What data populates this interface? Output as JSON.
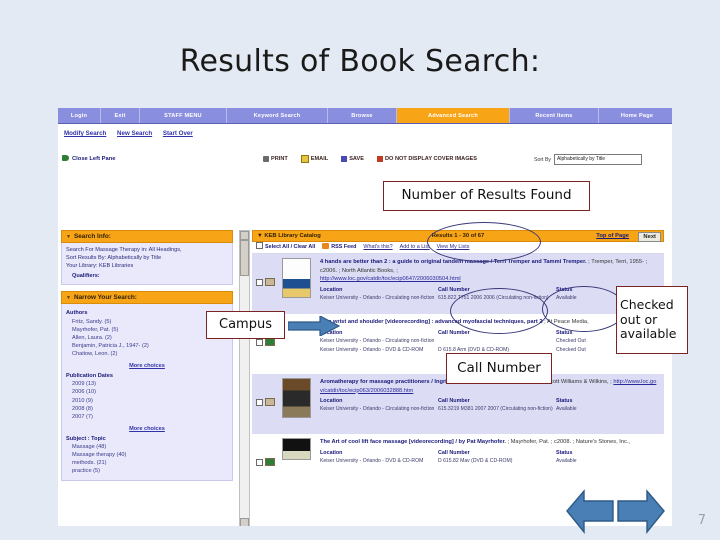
{
  "slide": {
    "title": "Results of Book Search:",
    "page_number": "7",
    "background_color": "#e3eaf3"
  },
  "annotations": {
    "results_found": "Number of Results Found",
    "campus": "Campus",
    "call_number": "Call Number",
    "checked_status": "Checked out or available",
    "accent_color": "#7b2222",
    "ellipse_color": "#3b3b7a",
    "arrow_color": "#4a7fb5"
  },
  "browser": {
    "nav": [
      {
        "label": "Login",
        "active": false
      },
      {
        "label": "Exit",
        "active": false
      },
      {
        "label": "STAFF MENU",
        "active": false
      },
      {
        "label": "Keyword Search",
        "active": false
      },
      {
        "label": "Browse",
        "active": false
      },
      {
        "label": "Advanced Search",
        "active": true
      },
      {
        "label": "Recent Items",
        "active": false
      },
      {
        "label": "Home Page",
        "active": false
      }
    ],
    "sub_links": [
      "Modify Search",
      "New Search",
      "Start Over"
    ],
    "close_pane": "Close Left Pane",
    "actions": [
      {
        "label": "PRINT",
        "icon": "printer-icon"
      },
      {
        "label": "EMAIL",
        "icon": "envelope-icon"
      },
      {
        "label": "SAVE",
        "icon": "floppy-disk-icon"
      },
      {
        "label": "DO NOT DISPLAY COVER IMAGES",
        "icon": "no-image-icon"
      }
    ],
    "sort": {
      "label": "Sort By",
      "value": "Alphabetically by Title"
    }
  },
  "sidebar": {
    "search_info": {
      "header": "Search Info:",
      "lines": [
        "Search For Massage Therapy in: All Headings,",
        "Sort Results By: Alphabetically by Title",
        "Your Library: KEB Libraries"
      ],
      "qualifiers": "Qualifiers:"
    },
    "narrow": {
      "header": "Narrow Your Search:",
      "groups": [
        {
          "name": "Authors",
          "items": [
            "Fritz, Sandy.  (5)",
            "Mayrhofer, Pat.  (5)",
            "Allen, Laura.  (2)",
            "Benjamin, Patricia J., 1947-  (2)",
            "Chaitow, Leon.  (2)"
          ],
          "more": "More choices"
        },
        {
          "name": "Publication Dates",
          "items": [
            "2009  (13)",
            "2006  (10)",
            "2010  (9)",
            "2008  (8)",
            "2007  (7)"
          ],
          "more": "More choices"
        },
        {
          "name": "Subject : Topic",
          "items": [
            "Massage  (48)",
            "Massage therapy  (40)",
            "methods.  (21)",
            "practice  (5)"
          ],
          "more": ""
        }
      ]
    }
  },
  "results": {
    "catalog_label": "KEB Library Catalog",
    "count_text": "Results 1 - 30 of 67",
    "top_of_page": "Top of Page",
    "next_button": "Next",
    "tools": {
      "select_all": "Select All / Clear All",
      "rss": "RSS Feed",
      "whats_this": "What's this?",
      "add_list": "Add to a List",
      "view_lists": "View My Lists"
    },
    "columns": {
      "location": "Location",
      "call_number": "Call Number",
      "status": "Status"
    },
    "items": [
      {
        "title": "4 hands are better than 2 : a guide to original tandem massage / Terri Tremper and Tammi Tremper.",
        "meta": "; Tremper, Terri, 1955- ; c2006. ; North Atlantic Books, ;",
        "url": "http://www.loc.gov/catdir/toc/ecip0647/2006030504.html",
        "copies": [
          {
            "location": "Keiser University - Orlando - Circulating non-fiction",
            "call_number": "615.822 T751 2006 2006 (Circulating non-fiction)",
            "status": "Available"
          }
        ]
      },
      {
        "title": "Arm wrist and shoulder [videorecording] : advanced myofascial techniques, part 2",
        "meta": "; At Peace Media,",
        "url": "",
        "copies": [
          {
            "location": "Keiser University - Orlando - Circulating non-fiction",
            "call_number": "",
            "status": "Checked Out"
          },
          {
            "location": "Keiser University - Orlando - DVD & CD-ROM",
            "call_number": "D 615.8 Arm (DVD & CD-ROM)",
            "status": "Checked Out"
          }
        ]
      },
      {
        "title": "Aromatherapy for massage practitioners / Ingrid Martin.",
        "meta": "; Martin, Ingrid ; c2007. ; Lippincott Williams & Wilkins, ;",
        "url": "http://www.loc.gov/catdir/toc/ecip063/2006032888.htm",
        "copies": [
          {
            "location": "Keiser University - Orlando - Circulating non-fiction",
            "call_number": "615.3219 M381 2007 2007 (Circulating non-fiction)",
            "status": "Available"
          }
        ]
      },
      {
        "title": "The Art of cool lift face massage [videorecording] / by Pat Mayrhofer.",
        "meta": "; Mayrhofer, Pat. ; c2008. ; Nature's Stones, Inc.,",
        "url": "",
        "copies": [
          {
            "location": "Keiser University - Orlando - DVD & CD-ROM",
            "call_number": "D 615.82 Mav (DVD & CD-ROM)",
            "status": "Available"
          }
        ]
      }
    ]
  }
}
